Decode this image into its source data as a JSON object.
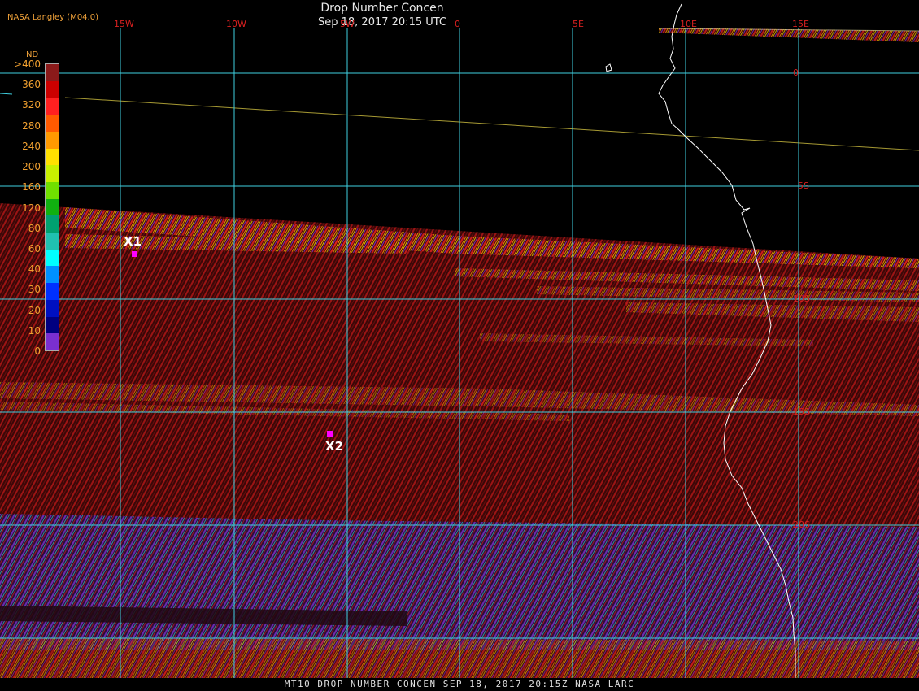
{
  "header": {
    "producer": "NASA Langley (M04.0)",
    "title": "Drop Number Concen",
    "datetime": "Sep 18, 2017 20:15 UTC"
  },
  "footer": {
    "caption": "MT10  DROP NUMBER CONCEN   SEP 18, 2017 20:15Z   NASA LARC"
  },
  "grid": {
    "longitude_labels": [
      "15W",
      "10W",
      "5W",
      "0",
      "5E",
      "10E",
      "15E"
    ],
    "latitude_labels": [
      "0",
      "5S",
      "10S",
      "15S",
      "20S"
    ],
    "line_color": "#3fd0e0",
    "label_color": "#d82020"
  },
  "legend": {
    "unit": "ND",
    "ticks": [
      ">400",
      "360",
      "320",
      "280",
      "240",
      "200",
      "160",
      "120",
      "80",
      "60",
      "40",
      "30",
      "20",
      "10",
      "0"
    ],
    "colors": [
      "#8b1a1a",
      "#cc0000",
      "#ff2020",
      "#ff5a00",
      "#ff9900",
      "#ffe000",
      "#c8f000",
      "#70e000",
      "#10b010",
      "#00a070",
      "#20c0b0",
      "#00ffff",
      "#0090ff",
      "#0030ff",
      "#0010c0",
      "#000080",
      "#7a2fd0"
    ]
  },
  "markers": [
    {
      "label": "X1",
      "color": "#ff00ff"
    },
    {
      "label": "X2",
      "color": "#ff00ff"
    }
  ],
  "coastline_color": "#ffffff"
}
